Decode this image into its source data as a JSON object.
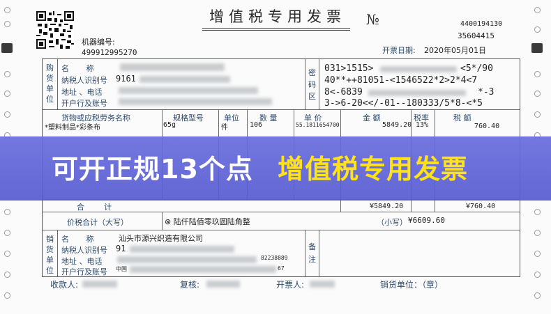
{
  "invoice": {
    "title": "增值税专用发票",
    "no_symbol": "№",
    "code_top": "4400194130",
    "code_bottom": "35604415",
    "machine_label": "机器编号:",
    "machine_no": "499912995270",
    "date_label": "开票日期:",
    "date_value": "2020年05月01日"
  },
  "buyer": {
    "section_label": "购货单位",
    "name_label": "名       称",
    "tax_label": "纳税人识别号",
    "tax_value": "9161",
    "addr_label": "地址 、电话",
    "bank_label": "开户行及账号"
  },
  "cipher": {
    "section_label": "密码区",
    "lines": [
      "031>1515>",
      "<5*/90",
      "40**++81051-<1546522*2>2*4<7",
      "8<-6839",
      "*-3",
      "3->6-20<</-01--180333/5*8-<*5"
    ]
  },
  "items": {
    "headers": {
      "name": "货物或应税劳务名称",
      "spec": "规格型号",
      "unit": "单位",
      "qty": "数 量",
      "price": "单 价",
      "amount": "金 额",
      "rate": "税率",
      "tax": "税 额"
    },
    "rows": [
      {
        "name": "*塑料制品*彩条布",
        "spec": "65g",
        "unit": "件",
        "qty": "106",
        "price": "55.1811654700",
        "amount": "5849.20",
        "rate": "13%",
        "tax": "760.40"
      }
    ]
  },
  "totals": {
    "sum_label": "合        计",
    "sum_amount": "¥5849.20",
    "sum_tax": "¥760.40",
    "grand_label": "价税合计（大写）",
    "grand_upper": "⊗ 陆仟陆佰零玖圆陆角整",
    "small_label": "（小写）",
    "small_value": "¥6609.60"
  },
  "seller": {
    "section_label": "销货单位",
    "name_label": "名       称",
    "name_value": "汕头市源兴织造有限公司",
    "tax_label": "纳税人识别号",
    "tax_value": "91",
    "addr_label": "地址 、电话",
    "addr_phone": "82238889",
    "bank_label": "开户行及账号",
    "bank_prefix": "中国",
    "bank_suffix": "67",
    "remark_label": "备注"
  },
  "footer": {
    "payee": "收款人:",
    "reviewer": "复核:",
    "drawer": "开票人:",
    "seller_stamp": "销货单位：（章）"
  },
  "banner": {
    "text_white": "可开正规13个点",
    "text_yellow": "增值税专用发票",
    "color_white": "#ffffff",
    "color_yellow": "#ffe21a",
    "color_band": "#6468dc"
  }
}
